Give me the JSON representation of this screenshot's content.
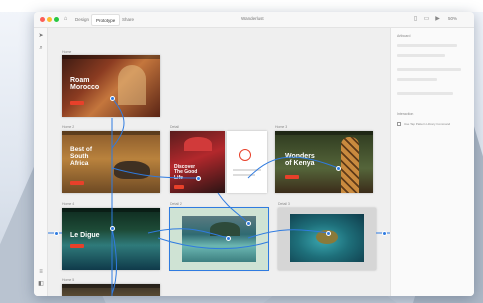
{
  "window": {
    "title": "Wanderlust",
    "tabs": [
      {
        "label": "Design"
      },
      {
        "label": "Prototype"
      },
      {
        "label": "Share"
      }
    ],
    "zoom": "50%"
  },
  "artboards": {
    "a1": {
      "label": "Home",
      "headline": "Roam\nMorocco"
    },
    "a2": {
      "label": "Home 2",
      "headline": "Best of\nSouth\nAfrica"
    },
    "a3": {
      "label": "Detail",
      "headline": "Discover\nThe Good\nLife"
    },
    "a4": {
      "label": "Home 3",
      "headline": "Wonders\nof Kenya"
    },
    "a5": {
      "label": "Home 4",
      "headline": "Le Digue"
    },
    "a6": {
      "label": "Detail 2"
    },
    "a7": {
      "label": "Detail 3"
    },
    "a8": {
      "label": "Home 5"
    }
  },
  "properties": {
    "section_label": "Artboard",
    "fields": [
      "",
      "",
      "",
      "",
      ""
    ],
    "interaction_label": "Interaction",
    "checkbox_label": "Use Tap Pattern Library Command"
  },
  "colors": {
    "accent": "#2f7be0",
    "cta": "#e8402a"
  }
}
